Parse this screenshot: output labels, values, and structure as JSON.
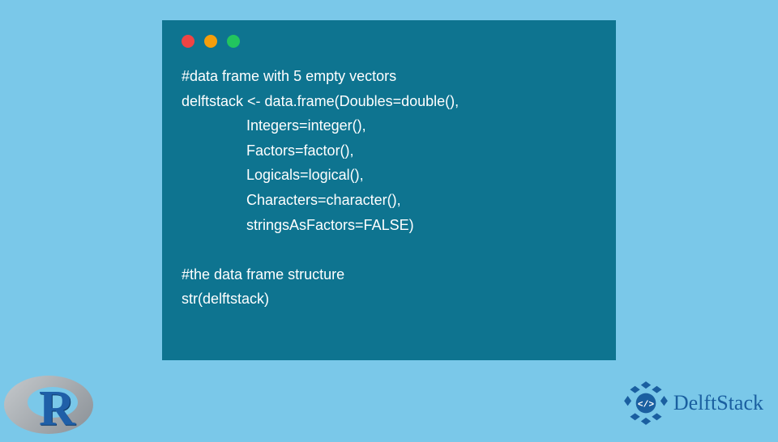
{
  "code": {
    "line1": "#data frame with 5 empty vectors",
    "line2": "delftstack <- data.frame(Doubles=double(),",
    "line3": "                Integers=integer(),",
    "line4": "                Factors=factor(),",
    "line5": "                Logicals=logical(),",
    "line6": "                Characters=character(),",
    "line7": "                stringsAsFactors=FALSE)",
    "line8": "",
    "line9": "#the data frame structure",
    "line10": "str(delftstack)"
  },
  "branding": {
    "r_letter": "R",
    "delftstack_label": "DelftStack"
  }
}
